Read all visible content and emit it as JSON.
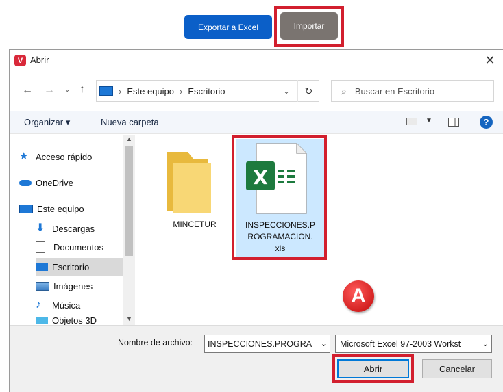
{
  "top": {
    "export_label": "Exportar a Excel",
    "import_label": "Importar"
  },
  "dialog": {
    "title": "Abrir",
    "close_glyph": "✕",
    "breadcrumb": [
      "Este equipo",
      "Escritorio"
    ],
    "search_placeholder": "Buscar en Escritorio",
    "toolbar": {
      "organize_label": "Organizar ▾",
      "new_folder_label": "Nueva carpeta",
      "help_glyph": "?"
    },
    "sidebar": [
      {
        "label": "Acceso rápido",
        "icon": "star-icon"
      },
      {
        "label": "OneDrive",
        "icon": "cloud-icon"
      },
      {
        "label": "Este equipo",
        "icon": "computer-icon"
      },
      {
        "label": "Descargas",
        "icon": "download-icon"
      },
      {
        "label": "Documentos",
        "icon": "document-icon"
      },
      {
        "label": "Escritorio",
        "icon": "desktop-icon",
        "selected": true
      },
      {
        "label": "Imágenes",
        "icon": "pictures-icon"
      },
      {
        "label": "Música",
        "icon": "music-icon"
      },
      {
        "label": "Objetos 3D",
        "icon": "cube-icon"
      }
    ],
    "files": [
      {
        "name": "MINCETUR",
        "type": "folder"
      },
      {
        "name_lines": [
          "INSPECCIONES.P",
          "ROGRAMACION.",
          "xls"
        ],
        "type": "excel",
        "selected": true
      }
    ],
    "filename_label": "Nombre de archivo:",
    "filename_value": "INSPECCIONES.PROGRA",
    "filetype_value": "Microsoft Excel 97-2003 Workst",
    "open_label": "Abrir",
    "cancel_label": "Cancelar"
  },
  "marker_label": "A",
  "colors": {
    "highlight": "#d21f2e",
    "accent": "#0b5fc8",
    "selection": "#cce8ff"
  }
}
